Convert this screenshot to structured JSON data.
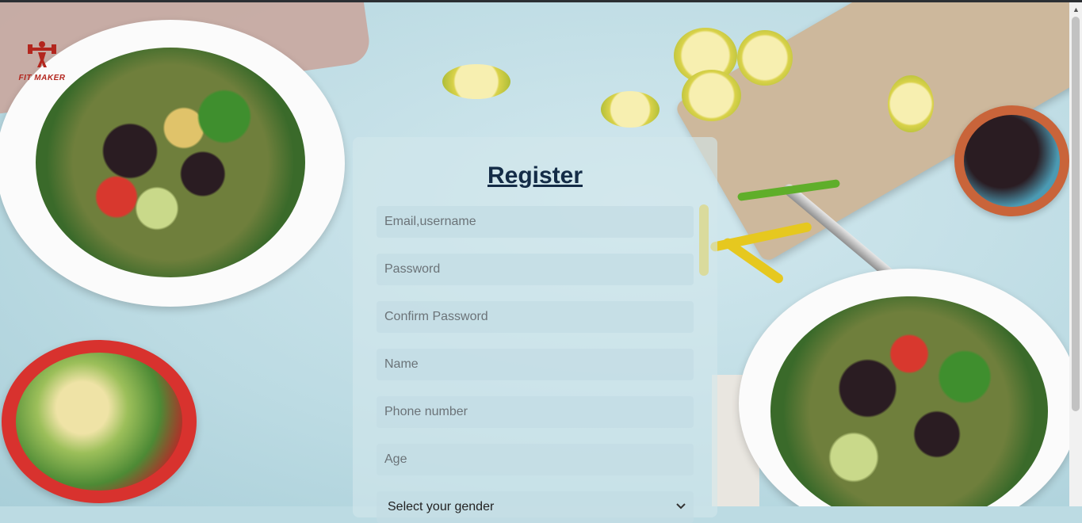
{
  "app": {
    "logo_text": "FIT MAKER"
  },
  "form": {
    "title": "Register",
    "fields": [
      {
        "name": "email",
        "placeholder": "Email,username"
      },
      {
        "name": "password",
        "placeholder": "Password"
      },
      {
        "name": "confirm_password",
        "placeholder": "Confirm Password"
      },
      {
        "name": "full_name",
        "placeholder": "Name"
      },
      {
        "name": "phone",
        "placeholder": "Phone number"
      },
      {
        "name": "age",
        "placeholder": "Age"
      }
    ],
    "gender_select": {
      "selected": "Select your gender"
    }
  },
  "colors": {
    "title": "#142c47",
    "logo": "#b3261e"
  },
  "icons": {
    "logo": "dumbbell-figure-icon",
    "select_arrow": "chevron-down-icon"
  }
}
